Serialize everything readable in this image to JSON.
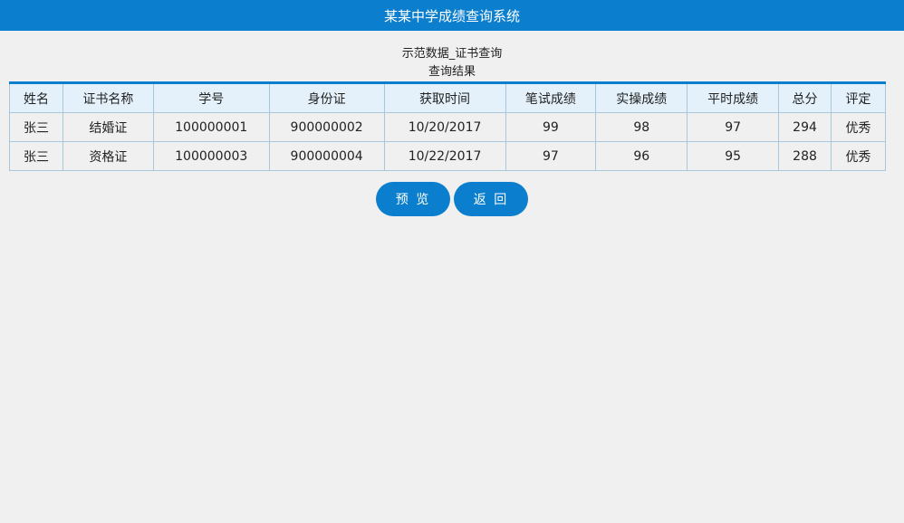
{
  "header": {
    "title": "某某中学成绩查询系统"
  },
  "titles": {
    "line1": "示范数据_证书查询",
    "line2": "查询结果"
  },
  "table": {
    "columns": [
      "姓名",
      "证书名称",
      "学号",
      "身份证",
      "获取时间",
      "笔试成绩",
      "实操成绩",
      "平时成绩",
      "总分",
      "评定"
    ],
    "rows": [
      [
        "张三",
        "结婚证",
        "100000001",
        "900000002",
        "10/20/2017",
        "99",
        "98",
        "97",
        "294",
        "优秀"
      ],
      [
        "张三",
        "资格证",
        "100000003",
        "900000004",
        "10/22/2017",
        "97",
        "96",
        "95",
        "288",
        "优秀"
      ]
    ]
  },
  "buttons": {
    "preview": "预 览",
    "back": "返 回"
  },
  "colors": {
    "accent": "#0b7fcd",
    "header_row": "#e4f1fa",
    "background": "#f0f0f0"
  }
}
